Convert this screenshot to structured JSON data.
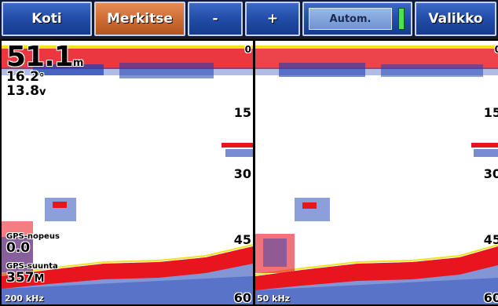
{
  "toolbar": {
    "home_label": "Koti",
    "mark_label": "Merkitse",
    "zoom_out_label": "-",
    "zoom_in_label": "+",
    "gain_label": "Autom.",
    "menu_label": "Valikko"
  },
  "readouts": {
    "depth_value": "51.1",
    "depth_unit": "m",
    "temp_value": "16.2",
    "temp_unit": "°",
    "voltage_value": "13.8",
    "voltage_unit": "v",
    "gps_speed_label": "GPS-nopeus",
    "gps_speed_value": "0.0",
    "gps_heading_label": "GPS-suunta",
    "gps_heading_value": "357",
    "gps_heading_unit": "M"
  },
  "left_pane": {
    "frequency": "200 kHz",
    "scale": [
      "0",
      "15",
      "30",
      "45",
      "60"
    ]
  },
  "right_pane": {
    "frequency": "50 kHz",
    "scale": [
      "0",
      "15",
      "30",
      "45",
      "60"
    ]
  },
  "colors": {
    "toolbar_blue": "#1f4aa6",
    "toolbar_active": "#cc6a33",
    "sonar_red": "#e8141e",
    "sonar_yellow": "#f2e21a",
    "sonar_blue": "#1c3fb5"
  }
}
